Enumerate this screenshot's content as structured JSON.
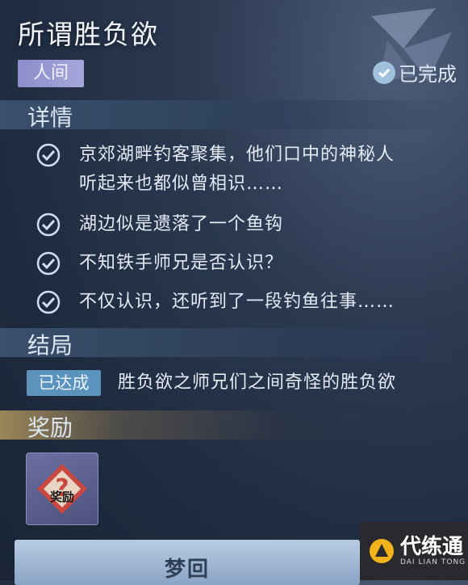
{
  "quest": {
    "title": "所谓胜负欲",
    "tag": "人间",
    "status": "已完成"
  },
  "details": {
    "heading": "详情",
    "items": [
      {
        "line1": "京郊湖畔钓客聚集，他们口中的神秘人",
        "line2": "听起来也都似曾相识……"
      },
      {
        "line1": "湖边似是遗落了一个鱼钩"
      },
      {
        "line1": "不知铁手师兄是否认识？"
      },
      {
        "line1": "不仅认识，还听到了一段钓鱼往事……"
      }
    ]
  },
  "ending": {
    "heading": "结局",
    "badge": "已达成",
    "text": "胜负欲之师兄们之间奇怪的胜负欲"
  },
  "reward": {
    "heading": "奖励",
    "item_label": "奖励"
  },
  "button": {
    "label": "梦回"
  },
  "watermark": {
    "cn": "代练通",
    "en": "DAI LIAN TONG"
  },
  "colors": {
    "tag_bg": "#a5a7dc",
    "badge_bg": "#5b93bd",
    "check": "#cfe0f0",
    "gold": "#b0965c"
  }
}
